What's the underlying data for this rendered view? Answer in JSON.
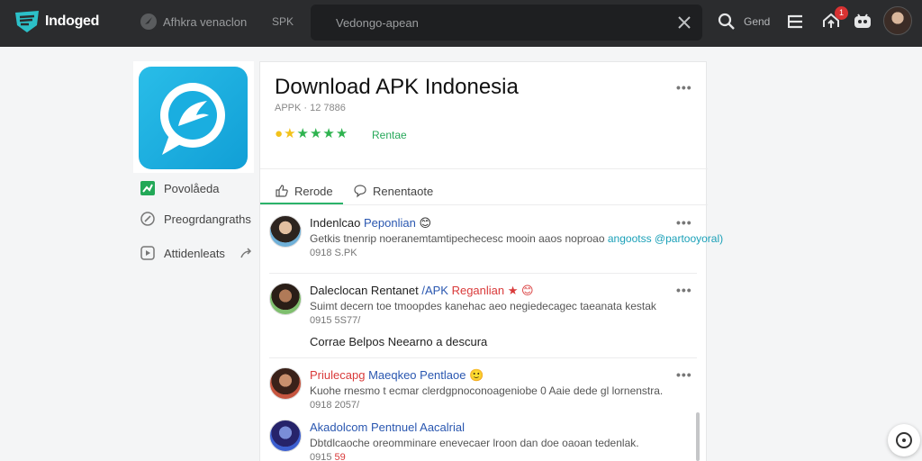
{
  "topbar": {
    "brand": "Indoged",
    "nav_link": "Afhkra venaclon",
    "nav_tag": "SPK",
    "search_placeholder": "Vedongo-apean",
    "user_label": "Gend",
    "notification_count": "1"
  },
  "app": {
    "title": "Download APK Indonesia",
    "meta": "APPK · 12 7886",
    "rating_label": "Rentae",
    "star_colors": [
      "#f2c21b",
      "#f2c21b",
      "#2eb34f",
      "#2eb34f",
      "#2eb34f",
      "#2eb34f"
    ]
  },
  "sidebar": {
    "items": [
      {
        "label": "Povolåeda",
        "icon": "chart-icon"
      },
      {
        "label": "Preogrdangraths",
        "icon": "compass-icon"
      },
      {
        "label": "Attidenleats",
        "icon": "play-icon"
      }
    ]
  },
  "tabs": [
    {
      "label": "Rerode",
      "icon": "thumbs-up-icon",
      "active": true
    },
    {
      "label": "Renentaote",
      "icon": "chat-bubble-icon",
      "active": false
    }
  ],
  "comments": [
    {
      "name": "Indenlcao",
      "name_tag": "Peponlian",
      "emoji": "😊",
      "body": "Getkis tnenrip noeranemtamtipechecesc mooin aaos noproao",
      "body_tag": "angootss @partooyoral)",
      "time": "0918 S.PK",
      "quote": ""
    },
    {
      "name": "Daleclocan Rentanet",
      "name_tag": "/APK",
      "name_tag2": "Reganlian",
      "emoji": "★ 😊",
      "body": "Suimt decern toe tmoopdes kanehac aeo negiedecagec taeanata kestak",
      "body_tag": "",
      "time": "0915 5S77/",
      "quote": "Corrae Belpos Neearno a descura"
    },
    {
      "name": "Priulecapg",
      "name_tag": "Maeqkeo Pentlaoe",
      "emoji": "🙂",
      "body": "Kuohe rnesmo t ecmar clerdgpnoconoageniobe 0 Aaie dede gl lornenstra.",
      "body_tag": "",
      "time": "0918 2057/",
      "quote": ""
    },
    {
      "name": "Akadolcom",
      "name_tag": "Pentnuel Aacalrial",
      "emoji": "",
      "body": "Dbtdlcaoche oreomminare enevecaer lroon dan doe oaoan tedenlak.",
      "body_tag": "",
      "time": "0915",
      "time_tag": "59",
      "quote": ""
    }
  ]
}
